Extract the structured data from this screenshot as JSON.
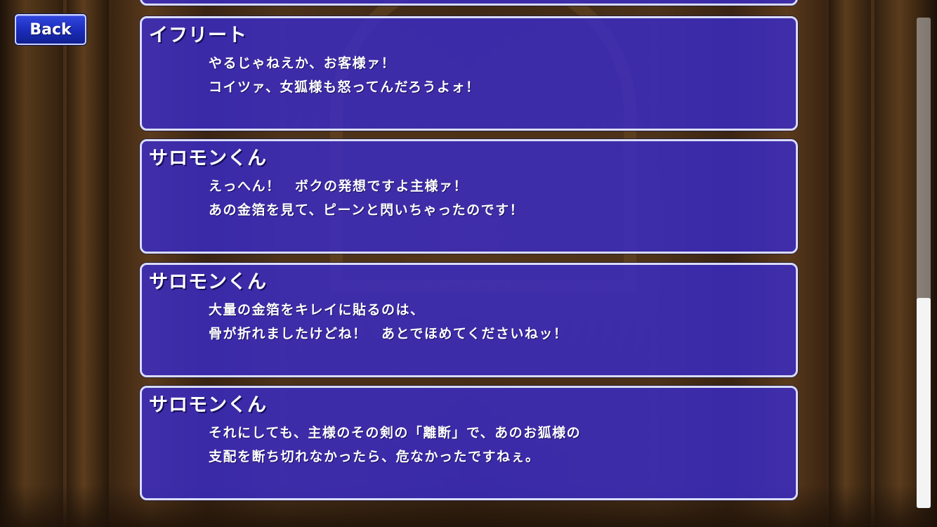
{
  "back_button": {
    "label": "Back"
  },
  "scroll": {
    "position_fraction": 0.57
  },
  "log_entries": [
    {
      "speaker": "イフリート",
      "lines": [
        "やるじゃねえか、お客様ァ！",
        "コイツァ、女狐様も怒ってんだろうよォ！"
      ]
    },
    {
      "speaker": "サロモンくん",
      "lines": [
        "えっへん！　ボクの発想ですよ主様ァ！",
        "あの金箔を見て、ピーンと閃いちゃったのです！"
      ]
    },
    {
      "speaker": "サロモンくん",
      "lines": [
        "大量の金箔をキレイに貼るのは、",
        "骨が折れましたけどね！　あとでほめてくださいねッ！"
      ]
    },
    {
      "speaker": "サロモンくん",
      "lines": [
        "それにしても、主様のその剣の「離断」で、あのお狐様の",
        "支配を断ち切れなかったら、危なかったですねぇ。"
      ]
    }
  ]
}
